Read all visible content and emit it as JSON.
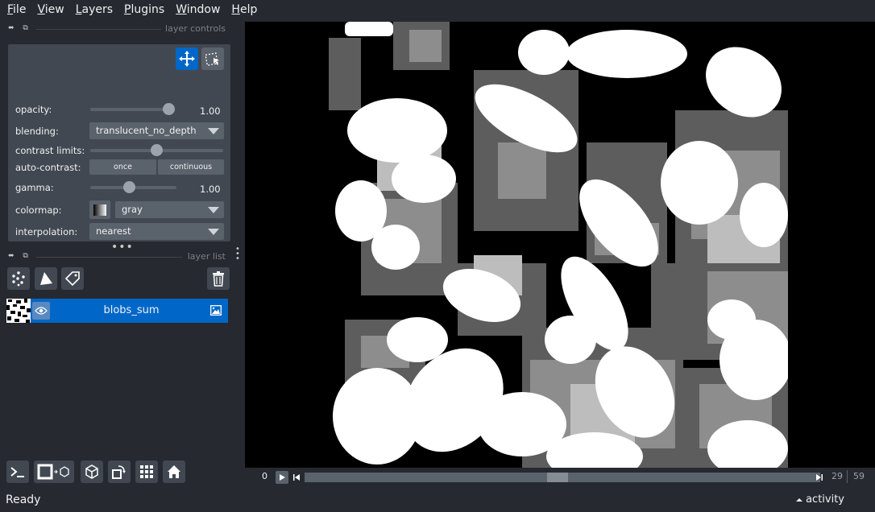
{
  "menu": [
    {
      "key": "F",
      "rest": "ile"
    },
    {
      "key": "V",
      "rest": "iew"
    },
    {
      "key": "L",
      "rest": "ayers"
    },
    {
      "key": "P",
      "rest": "lugins"
    },
    {
      "key": "W",
      "rest": "indow"
    },
    {
      "key": "H",
      "rest": "elp"
    }
  ],
  "layer_controls": {
    "title": "layer controls",
    "opacity_label": "opacity:",
    "opacity_value": "1.00",
    "opacity_level": 1.0,
    "blending_label": "blending:",
    "blending_value": "translucent_no_depth",
    "contrast_label": "contrast limits:",
    "contrast_level": 0.5,
    "autocontrast_label": "auto-contrast:",
    "once_label": "once",
    "continuous_label": "continuous",
    "gamma_label": "gamma:",
    "gamma_value": "1.00",
    "gamma_level": 0.45,
    "colormap_label": "colormap:",
    "colormap_value": "gray",
    "interpolation_label": "interpolation:",
    "interpolation_value": "nearest"
  },
  "layer_list": {
    "title": "layer list",
    "layers": [
      {
        "name": "blobs_sum",
        "visible": true,
        "selected": true
      }
    ]
  },
  "dims": {
    "left_value": "0",
    "current": "29",
    "total": "59",
    "position_fraction": 0.49
  },
  "status": {
    "text": "Ready",
    "activity": "activity"
  },
  "colors": {
    "accent": "#0067c8",
    "panel": "#414851",
    "background": "#262930"
  }
}
